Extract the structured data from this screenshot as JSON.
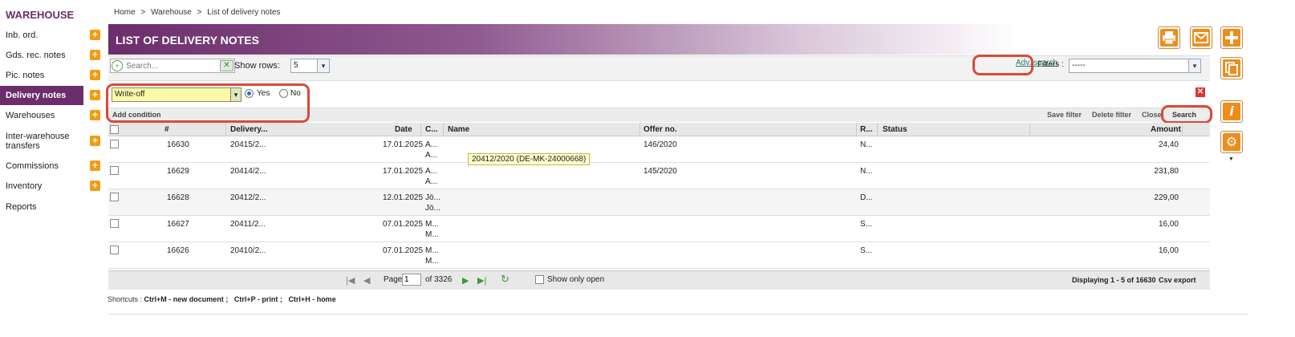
{
  "sidebar": {
    "title": "WAREHOUSE",
    "items": [
      {
        "label": "Inb. ord."
      },
      {
        "label": "Gds. rec. notes"
      },
      {
        "label": "Pic. notes"
      },
      {
        "label": "Delivery notes"
      },
      {
        "label": "Warehouses"
      },
      {
        "label": "Inter-warehouse transfers"
      },
      {
        "label": "Commissions"
      },
      {
        "label": "Inventory"
      },
      {
        "label": "Reports"
      }
    ]
  },
  "breadcrumb": {
    "home": "Home",
    "sep": ">",
    "warehouse": "Warehouse",
    "current": "List of delivery notes"
  },
  "page": {
    "title": "LIST OF DELIVERY NOTES"
  },
  "toolbar": {
    "search_placeholder": "Search...",
    "show_rows_label": "Show rows:",
    "show_rows_value": "5",
    "adv_search": "Adv. search",
    "filters_label": "Filters :",
    "filters_value": "-----"
  },
  "condition": {
    "field": "Write-off",
    "yes": "Yes",
    "no": "No",
    "add_condition": "Add condition",
    "save_filter": "Save filter",
    "delete_filter": "Delete filter",
    "close": "Close",
    "search": "Search"
  },
  "table": {
    "columns": [
      "#",
      "Delivery...",
      "Date",
      "C...",
      "Name",
      "Offer no.",
      "R...",
      "Status",
      "Amount"
    ],
    "rows": [
      {
        "id": "16630",
        "delivery": "20415/2...",
        "date": "17.01.2025",
        "c1": "A...",
        "c2": "A...",
        "offer": "146/2020",
        "r": "N...",
        "amount": "24,40"
      },
      {
        "id": "16629",
        "delivery": "20414/2...",
        "date": "17.01.2025",
        "c1": "A...",
        "c2": "A...",
        "offer": "145/2020",
        "r": "N...",
        "amount": "231,80"
      },
      {
        "id": "16628",
        "delivery": "20412/2...",
        "date": "12.01.2025",
        "c1": "Jö...",
        "c2": "Jö...",
        "offer": "",
        "r": "D...",
        "amount": "229,00"
      },
      {
        "id": "16627",
        "delivery": "20411/2...",
        "date": "07.01.2025",
        "c1": "M...",
        "c2": "M...",
        "offer": "",
        "r": "S...",
        "amount": "16,00"
      },
      {
        "id": "16626",
        "delivery": "20410/2...",
        "date": "07.01.2025",
        "c1": "M...",
        "c2": "M...",
        "offer": "",
        "r": "S...",
        "amount": "16,00"
      }
    ],
    "tooltip": "20412/2020 (DE-MK-24000668)"
  },
  "pager": {
    "page_label": "Page",
    "page_value": "1",
    "of_label": "of 3326",
    "show_only_open": "Show only open",
    "displaying": "Displaying 1 - 5 of 16630",
    "csv": "Csv export"
  },
  "shortcuts": {
    "prefix": "Shortcuts :",
    "s1": "Ctrl+M - new document ;",
    "s2": "Ctrl+P - print ;",
    "s3": "Ctrl+H - home"
  },
  "icons": {
    "print": "print-icon",
    "mail": "mail-icon",
    "add": "plus-icon",
    "copy": "copy-icon",
    "info": "info-icon",
    "settings": "gear-icon"
  },
  "colors": {
    "brand": "#6b2d6b",
    "accent": "#f08c1a",
    "highlight": "#d84a3a"
  }
}
